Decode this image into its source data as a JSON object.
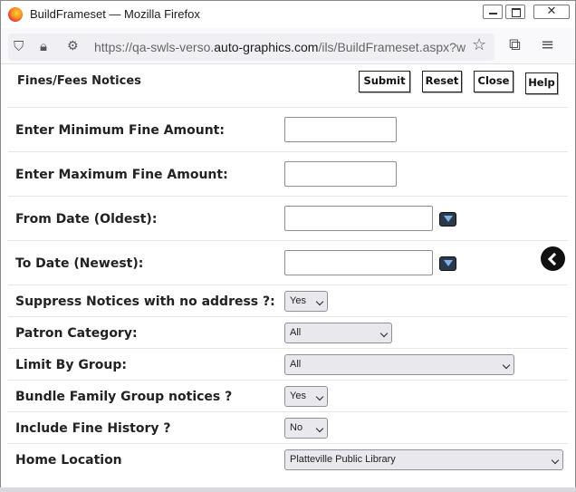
{
  "window": {
    "title": "BuildFrameset — Mozilla Firefox",
    "close_glyph": "✕"
  },
  "urlbar": {
    "url_prefix": "https://qa-swls-verso.",
    "url_host": "auto-graphics.com",
    "url_suffix": "/ils/BuildFrameset.aspx?w="
  },
  "icons": {
    "firefox": "firefox-logo",
    "shield": "shield-icon",
    "lock": "lock-icon",
    "permissions": "permissions-icon",
    "star": "star-icon",
    "extensions": "extensions-icon",
    "menu": "hamburger-menu-icon",
    "back": "back-arrow-icon",
    "calendar": "calendar-dropdown-icon"
  },
  "page": {
    "title": "Fines/Fees Notices"
  },
  "actions": {
    "submit": "Submit",
    "reset": "Reset",
    "close": "Close",
    "help": "Help"
  },
  "form": {
    "min_fine": {
      "label": "Enter Minimum Fine Amount:",
      "value": ""
    },
    "max_fine": {
      "label": "Enter Maximum Fine Amount:",
      "value": ""
    },
    "from_date": {
      "label": "From Date (Oldest):",
      "value": ""
    },
    "to_date": {
      "label": "To Date (Newest):",
      "value": ""
    },
    "suppress": {
      "label": "Suppress Notices with no address ?:",
      "value": "Yes"
    },
    "patron_category": {
      "label": "Patron Category:",
      "value": "All"
    },
    "limit_group": {
      "label": "Limit By Group:",
      "value": "All"
    },
    "bundle": {
      "label": "Bundle Family Group notices ?",
      "value": "Yes"
    },
    "fine_history": {
      "label": "Include Fine History ?",
      "value": "No"
    },
    "home_location": {
      "label": "Home Location",
      "value": "Platteville Public Library"
    }
  },
  "colors": {
    "calendar_button": "#2a3a4a",
    "select_bg": "#e9e9ed",
    "url_bg": "#f0f0f4"
  }
}
